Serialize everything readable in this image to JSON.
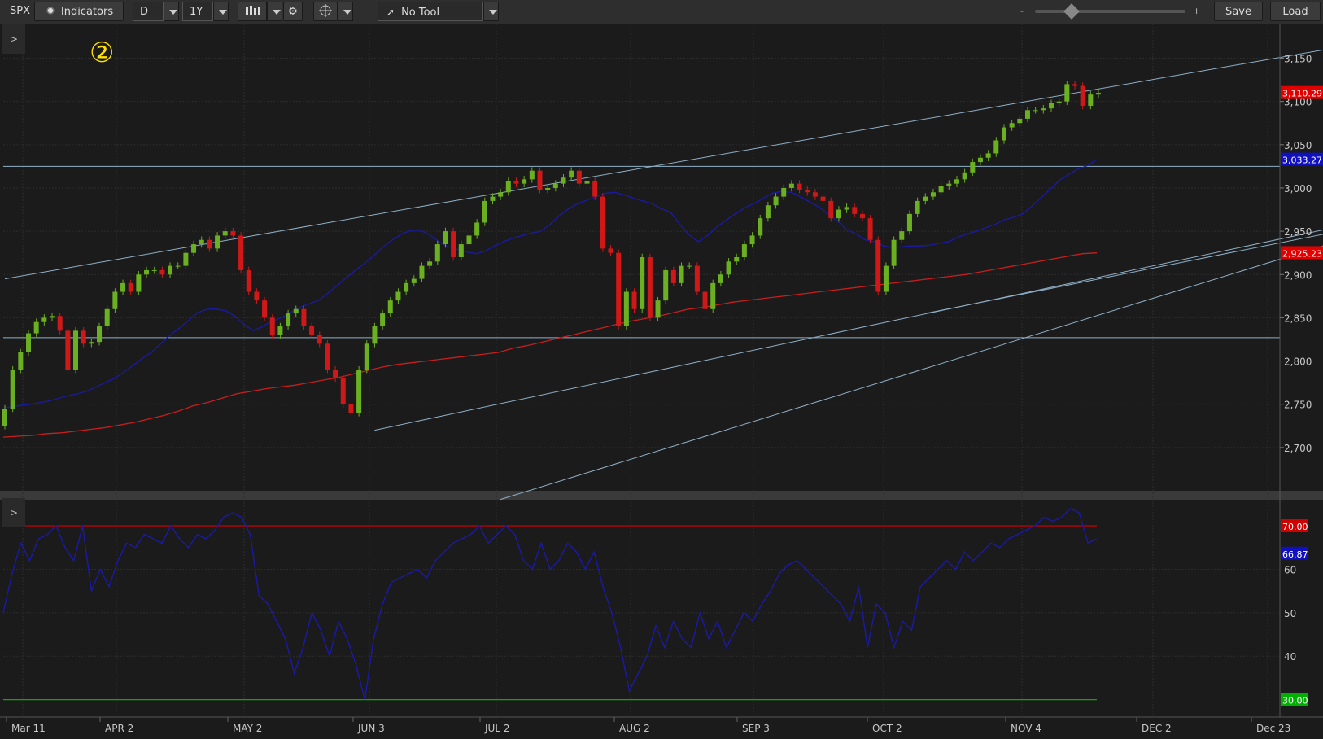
{
  "toolbar": {
    "symbol": "SPX",
    "indicators_label": "Indicators",
    "aggregation": "D",
    "period": "1Y",
    "tool_label": "No Tool",
    "zoom_minus": "-",
    "zoom_plus": "+",
    "save_label": "Save",
    "load_label": "Load"
  },
  "annotation": {
    "marker": "②"
  },
  "panel_toggle": ">",
  "chart_data": [
    {
      "type": "candlestick",
      "symbol": "SPX",
      "x_tick_labels": [
        "Mar 11",
        "APR 2",
        "MAY 2",
        "JUN 3",
        "JUL 2",
        "AUG 2",
        "SEP 3",
        "OCT 2",
        "NOV 4",
        "DEC 2",
        "Dec 23"
      ],
      "y_tick_labels": [
        "3,150",
        "3,100",
        "3,050",
        "3,000",
        "2,950",
        "2,900",
        "2,850",
        "2,800",
        "2,750",
        "2,700"
      ],
      "ylim": [
        2650,
        3190
      ],
      "price_labels": [
        {
          "text": "3,110.29",
          "color": "#e00000"
        },
        {
          "text": "3,033.27",
          "color": "#1010c0"
        },
        {
          "text": "2,925.23",
          "color": "#e00000"
        }
      ],
      "horizontal_lines": [
        3025,
        2827
      ],
      "series": [
        {
          "values": [
            2745,
            2790,
            2810,
            2832,
            2845,
            2850,
            2852,
            2835,
            2790,
            2835,
            2820,
            2822,
            2840,
            2860,
            2880,
            2890,
            2880,
            2900,
            2905,
            2905,
            2900,
            2910,
            2910,
            2925,
            2935,
            2940,
            2930,
            2945,
            2950,
            2945,
            2905,
            2880,
            2870,
            2850,
            2830,
            2840,
            2855,
            2860,
            2840,
            2830,
            2820,
            2790,
            2780,
            2750,
            2740,
            2790,
            2820,
            2840,
            2855,
            2870,
            2880,
            2890,
            2895,
            2910,
            2915,
            2935,
            2950,
            2920,
            2935,
            2945,
            2960,
            2985,
            2990,
            2995,
            3008,
            3005,
            3010,
            3020,
            2998,
            3000,
            3005,
            3012,
            3020,
            3005,
            3008,
            2990,
            2930,
            2925,
            2840,
            2880,
            2860,
            2920,
            2850,
            2870,
            2905,
            2890,
            2910,
            2910,
            2880,
            2860,
            2890,
            2900,
            2915,
            2920,
            2935,
            2945,
            2965,
            2980,
            2990,
            3000,
            3005,
            2998,
            2995,
            2990,
            2985,
            2965,
            2975,
            2978,
            2970,
            2965,
            2940,
            2880,
            2910,
            2940,
            2950,
            2970,
            2985,
            2990,
            2995,
            3002,
            3005,
            3010,
            3018,
            3030,
            3035,
            3040,
            3055,
            3070,
            3075,
            3080,
            3090,
            3090,
            3092,
            3098,
            3100,
            3120,
            3118,
            3095,
            3108,
            3110
          ]
        },
        {
          "values": [
            2746,
            2747,
            2749,
            2750,
            2752,
            2754,
            2757,
            2760,
            2762,
            2765,
            2770,
            2775,
            2780,
            2787,
            2795,
            2803,
            2810,
            2820,
            2830,
            2838,
            2847,
            2856,
            2860,
            2860,
            2858,
            2852,
            2842,
            2835,
            2840,
            2846,
            2850,
            2856,
            2862,
            2866,
            2870,
            2878,
            2887,
            2896,
            2905,
            2913,
            2922,
            2932,
            2940,
            2947,
            2951,
            2951,
            2946,
            2938,
            2932,
            2929,
            2926,
            2924,
            2927,
            2933,
            2938,
            2942,
            2945,
            2948,
            2950,
            2958,
            2968,
            2976,
            2982,
            2986,
            2990,
            2994,
            2995,
            2992,
            2988,
            2985,
            2982,
            2976,
            2972,
            2958,
            2946,
            2938,
            2945,
            2955,
            2963,
            2970,
            2977,
            2982,
            2988,
            2994,
            2996,
            2995,
            2990,
            2984,
            2978,
            2970,
            2962,
            2952,
            2947,
            2940,
            2938,
            2933,
            2931,
            2932,
            2933,
            2933,
            2934,
            2936,
            2938,
            2943,
            2947,
            2950,
            2954,
            2958,
            2963,
            2966,
            2970,
            2979,
            2989,
            2999,
            3009,
            3016,
            3022,
            3026,
            3033
          ]
        },
        {
          "values": [
            2712,
            2713,
            2714,
            2716,
            2717,
            2719,
            2721,
            2723,
            2726,
            2729,
            2733,
            2737,
            2742,
            2748,
            2752,
            2757,
            2762,
            2765,
            2768,
            2770,
            2772,
            2775,
            2778,
            2781,
            2785,
            2789,
            2793,
            2796,
            2798,
            2800,
            2802,
            2804,
            2806,
            2808,
            2810,
            2815,
            2818,
            2822,
            2826,
            2830,
            2834,
            2838,
            2842,
            2846,
            2849,
            2852,
            2856,
            2860,
            2862,
            2865,
            2868,
            2870,
            2872,
            2874,
            2876,
            2878,
            2880,
            2882,
            2884,
            2886,
            2888,
            2890,
            2892,
            2894,
            2896,
            2898,
            2900,
            2903,
            2906,
            2909,
            2912,
            2915,
            2918,
            2921,
            2924,
            2925
          ]
        }
      ]
    },
    {
      "type": "line",
      "indicator": "RSI",
      "y_tick_labels": [
        "60",
        "50",
        "40"
      ],
      "ylim": [
        26,
        76
      ],
      "reference_lines": [
        {
          "value": 70,
          "label": "70.00",
          "color": "#d00000"
        },
        {
          "value": 30,
          "label": "30.00",
          "color": "#00b000"
        }
      ],
      "current_label": "66.87",
      "series": [
        {
          "values": [
            50,
            59,
            66,
            62,
            67,
            68,
            70,
            65,
            62,
            70,
            55,
            60,
            56,
            62,
            66,
            65,
            68,
            67,
            66,
            70,
            67,
            65,
            68,
            67,
            69,
            72,
            73,
            72,
            68,
            54,
            52,
            48,
            44,
            36,
            42,
            50,
            46,
            40,
            48,
            44,
            38,
            30,
            44,
            52,
            57,
            58,
            59,
            60,
            58,
            62,
            64,
            66,
            67,
            68,
            70,
            66,
            68,
            70,
            68,
            62,
            60,
            66,
            60,
            62,
            66,
            64,
            60,
            64,
            56,
            50,
            42,
            32,
            36,
            40,
            47,
            42,
            48,
            44,
            42,
            50,
            44,
            48,
            42,
            46,
            50,
            48,
            52,
            55,
            59,
            61,
            62,
            60,
            58,
            56,
            54,
            52,
            48,
            56,
            42,
            52,
            50,
            42,
            48,
            46,
            56,
            58,
            60,
            62,
            60,
            64,
            62,
            64,
            66,
            65,
            67,
            68,
            69,
            70,
            72,
            71,
            72,
            74,
            73,
            66,
            67
          ]
        }
      ]
    }
  ]
}
